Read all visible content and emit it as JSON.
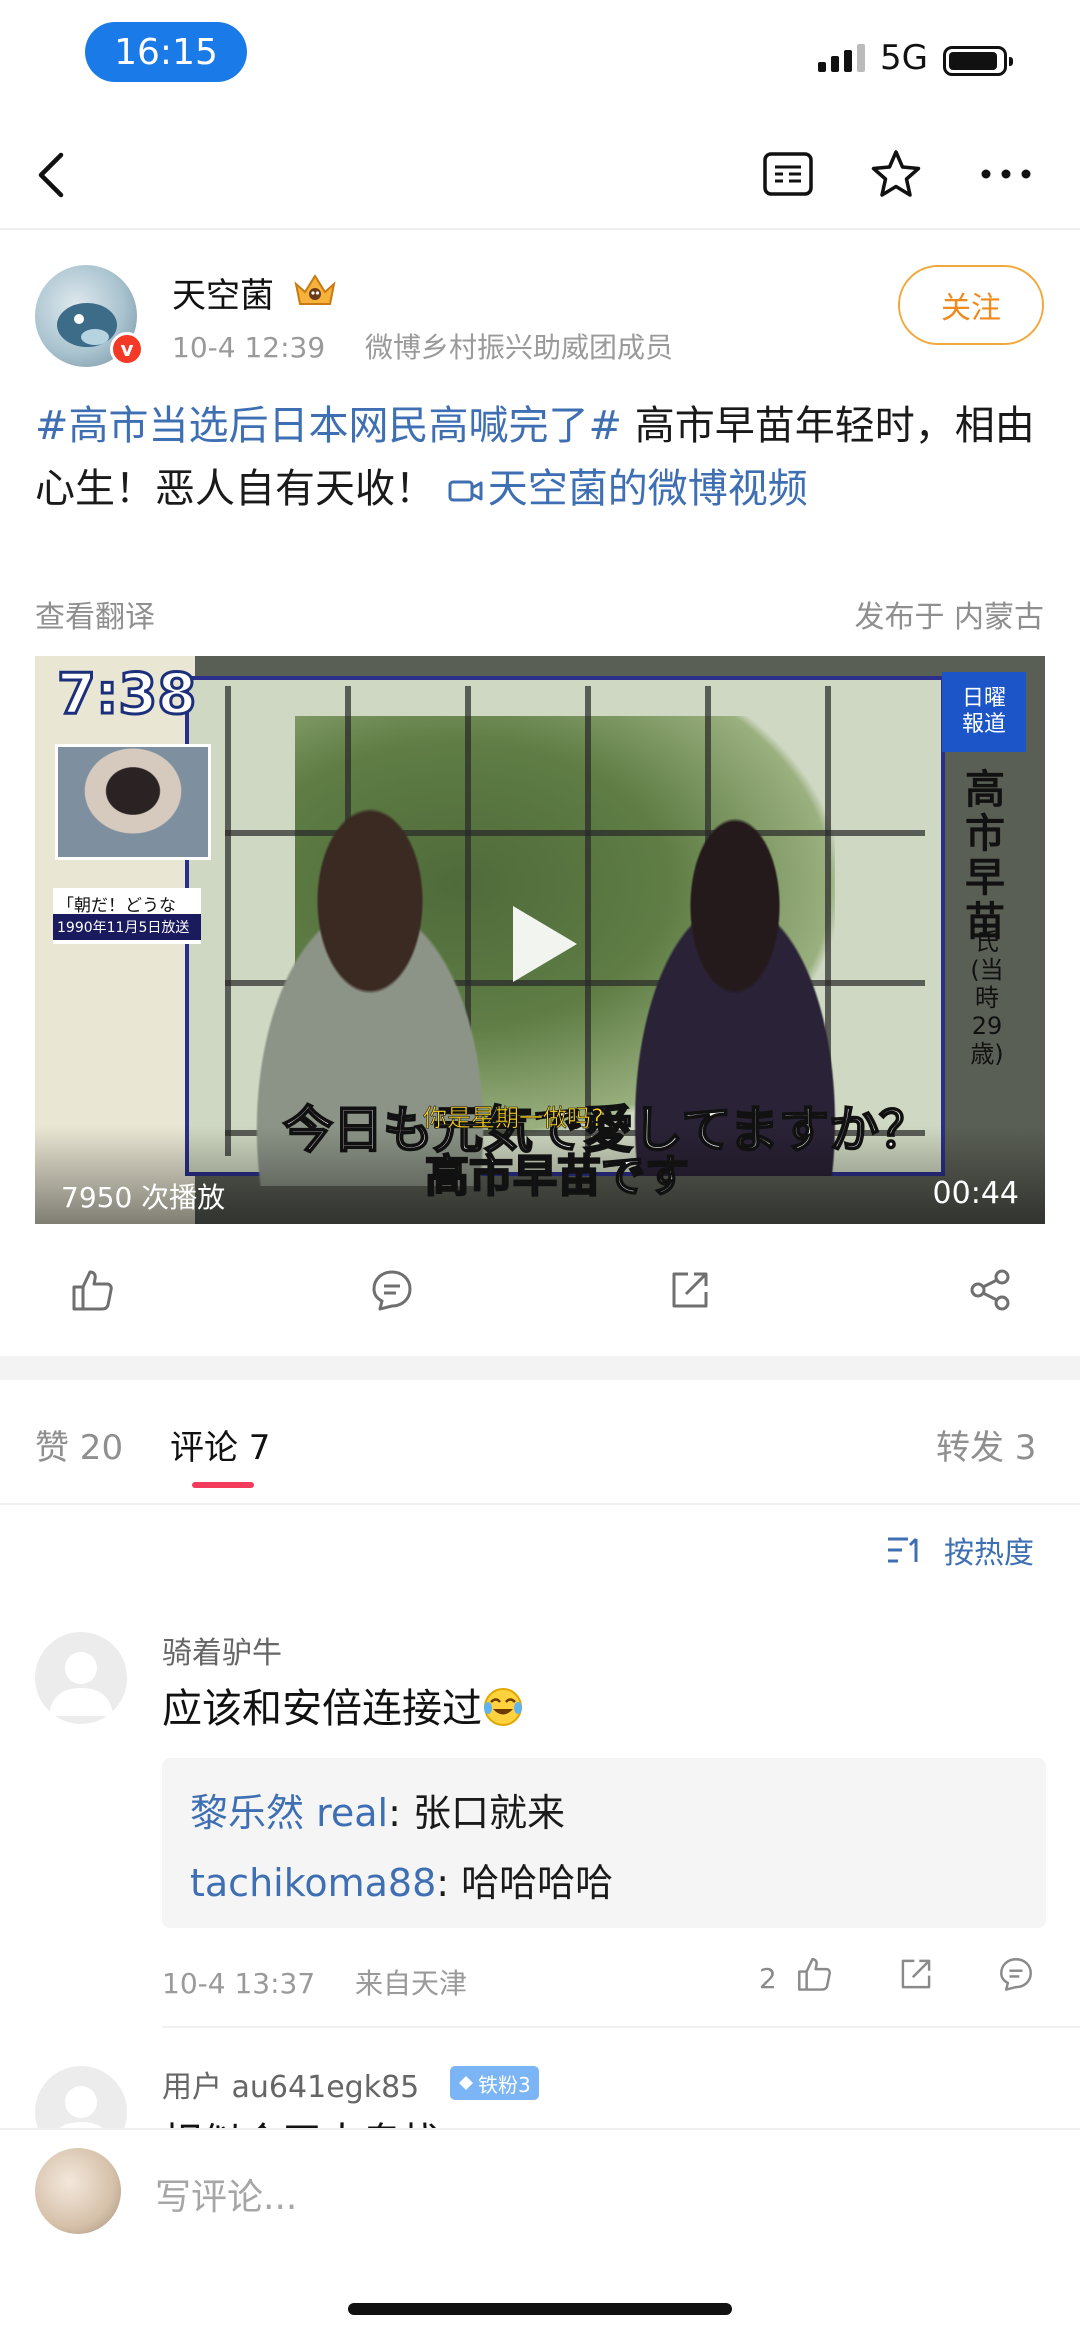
{
  "status_bar": {
    "time": "16:15",
    "network": "5G"
  },
  "post": {
    "author": "天空菌",
    "verified_badge": "v",
    "time": "10-4 12:39",
    "source": "微博乡村振兴助威团成员",
    "follow_label": "关注",
    "hashtag": "#高市当选后日本网民高喊完了#",
    "text": " 高市早苗年轻时，相由心生！恶人自有天收！ ",
    "video_link": "天空菌的微博视频",
    "translate_label": "查看翻译",
    "location": "发布于 内蒙古"
  },
  "video": {
    "views": "7950 次播放",
    "duration": "00:44",
    "overlay_time": "7:38",
    "caption_show": "「朝だ！どうなる」",
    "caption_date": "1990年11月5日放送",
    "logo_line1": "日曜",
    "logo_line2": "報道",
    "vertical_name": "高市早苗",
    "vertical_note": "氏(当時29歳)",
    "subtitle_jp": "今日も元気で愛してますか？",
    "subtitle_cn": "你是星期一做吗?",
    "subtitle_jp2": "高市早苗です"
  },
  "tabs": {
    "likes": "赞 20",
    "comments": "评论 7",
    "reposts": "转发 3"
  },
  "sort_label": "按热度",
  "comments": [
    {
      "name": "骑着驴牛",
      "text": "应该和安倍连接过",
      "replies": [
        {
          "who": "黎乐然 real",
          "text": ": 张口就来"
        },
        {
          "who": "tachikoma88",
          "text": ": 哈哈哈哈"
        }
      ],
      "time": "10-4 13:37",
      "from": "来自天津",
      "likes": "2"
    },
    {
      "name": "用户 au641egk85",
      "fan_badge": "铁粉3",
      "text": "相似合天大鬼找"
    }
  ],
  "comment_input_placeholder": "写评论...",
  "colors": {
    "accent_link": "#3f6fb3",
    "follow": "#f08a1d",
    "tab_indicator": "#f33b5b",
    "time_pill": "#1a7ae8"
  },
  "icons": [
    "back-icon",
    "reader-icon",
    "star-icon",
    "more-icon",
    "like-icon",
    "comment-icon",
    "share-icon",
    "forward-icon",
    "sort-icon",
    "play-icon"
  ]
}
